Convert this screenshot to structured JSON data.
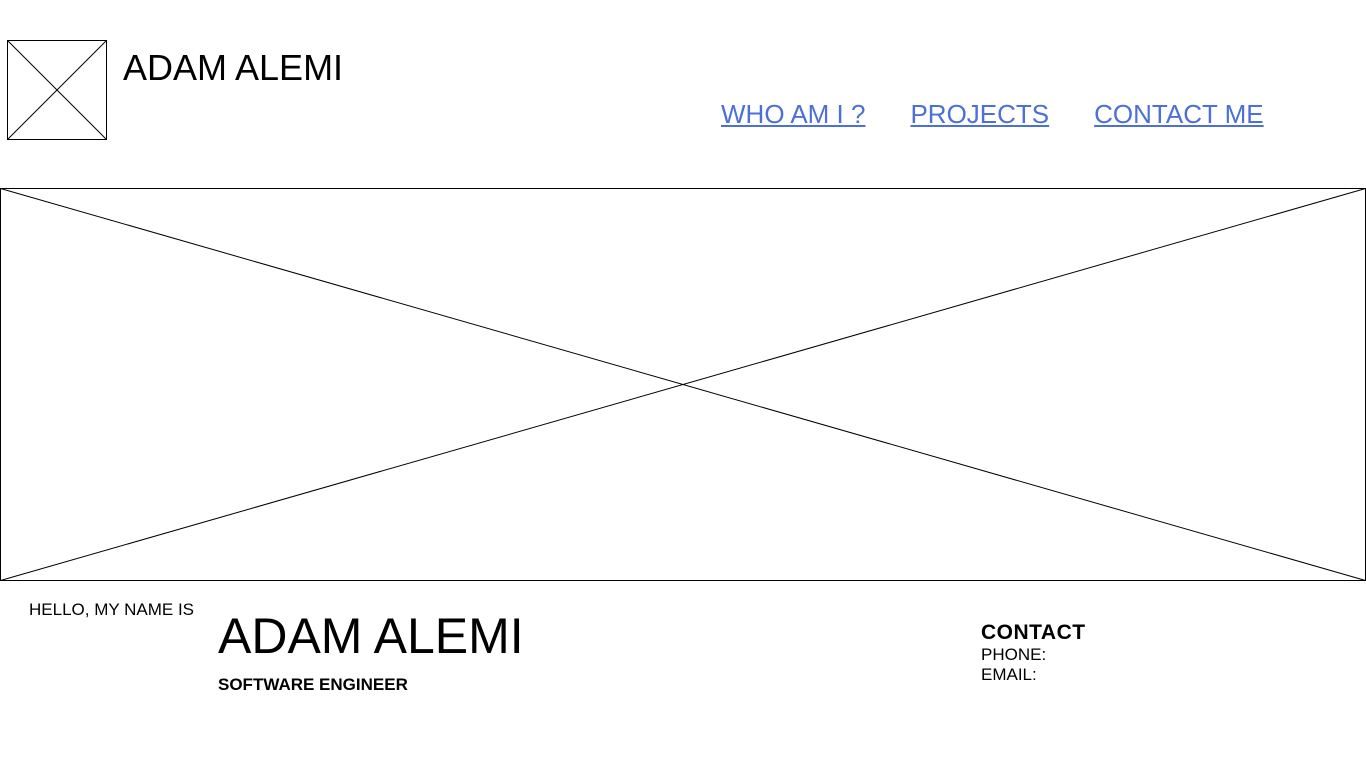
{
  "header": {
    "site_title": "ADAM ALEMI",
    "nav": [
      {
        "label": "WHO AM I ?"
      },
      {
        "label": "PROJECTS"
      },
      {
        "label": "CONTACT ME"
      }
    ],
    "link_color": "#4d6fd9"
  },
  "intro": {
    "greeting": "HELLO, MY NAME IS",
    "name": "ADAM ALEMI",
    "role": "SOFTWARE ENGINEER"
  },
  "contact": {
    "title": "CONTACT",
    "phone_label": "PHONE:",
    "email_label": "EMAIL:"
  }
}
